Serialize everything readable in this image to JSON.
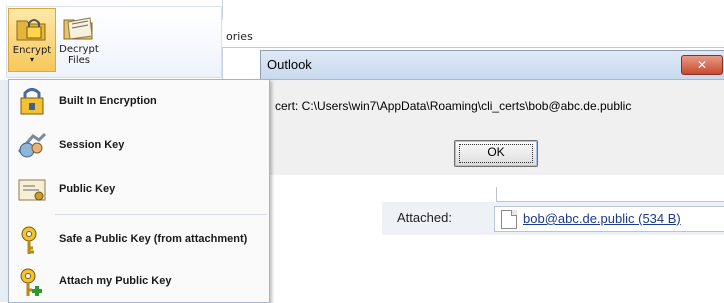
{
  "ribbon": {
    "encrypt": {
      "label": "Encrypt",
      "arrow": "▾",
      "icon": "lock-folder-icon"
    },
    "decrypt": {
      "label_line1": "Decrypt",
      "label_line2": "Files",
      "icon": "unlock-folder-icon"
    }
  },
  "background_window": {
    "tab_text": "ories"
  },
  "dialog": {
    "title": "Outlook",
    "message": "cert: C:\\Users\\win7\\AppData\\Roaming\\cli_certs\\bob@abc.de.public",
    "ok_label": "OK",
    "close_symbol": "✕"
  },
  "compose": {
    "attached_label": "Attached:",
    "attachment_name": "bob@abc.de.public (534 B)"
  },
  "menu": {
    "items": [
      {
        "label": "Built In Encryption",
        "icon": "encryption-icon"
      },
      {
        "label": "Session Key",
        "icon": "session-key-icon"
      },
      {
        "label": "Public Key",
        "icon": "public-key-icon"
      },
      {
        "label": "Safe a Public Key (from attachment)",
        "icon": "save-key-icon"
      },
      {
        "label": "Attach my Public Key",
        "icon": "attach-key-icon"
      }
    ]
  },
  "colors": {
    "accent": "#f7c75b",
    "link": "#1b3a8c",
    "close": "#c74a2f"
  }
}
